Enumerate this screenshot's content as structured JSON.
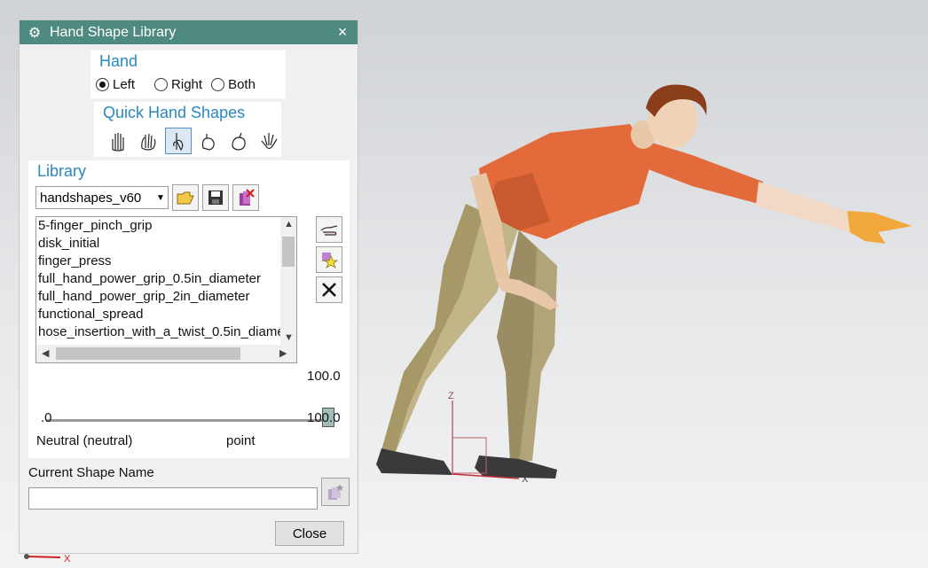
{
  "dialog": {
    "title": "Hand Shape Library",
    "close_glyph": "×",
    "hand_group": {
      "title": "Hand",
      "options": [
        "Left",
        "Right",
        "Both"
      ],
      "selected": "Left"
    },
    "quick_group": {
      "title": "Quick Hand Shapes",
      "shapes": [
        "open-hand-icon",
        "relaxed-hand-icon",
        "point-hand-icon",
        "curled-hand-icon",
        "pinch-hand-icon",
        "spread-hand-icon"
      ],
      "selected_index": 2
    },
    "library_group": {
      "title": "Library",
      "combo_value": "handshapes_v60",
      "tool_icons": [
        "open-folder-icon",
        "save-icon",
        "delete-library-icon"
      ],
      "side_icons": [
        "apply-shape-icon",
        "add-favorite-icon",
        "delete-icon"
      ],
      "items": [
        "5-finger_pinch_grip",
        "disk_initial",
        "finger_press",
        "full_hand_power_grip_0.5in_diameter",
        "full_hand_power_grip_2in_diameter",
        "functional_spread",
        "hose_insertion_with_a_twist_0.5in_diame"
      ],
      "slider_value_top": "100.0",
      "slider_min_label": ".0",
      "slider_max_label": "100.0",
      "slider_fraction": 1.0,
      "from_shape": "Neutral (neutral)",
      "to_shape": "point"
    },
    "current_shape_label": "Current Shape Name",
    "current_shape_value": "",
    "save_shape_icon": "save-shape-icon",
    "close_label": "Close"
  },
  "viewport": {
    "axis_z": "Z",
    "axis_x": "X",
    "corner_axis_x": "X",
    "colors": {
      "shirt": "#e36a3a",
      "pants": "#b7a97c",
      "skin": "#f0c9a6",
      "shoes": "#3a3a3a",
      "hair": "#8a3f1a",
      "hand": "#f0a83a"
    }
  }
}
